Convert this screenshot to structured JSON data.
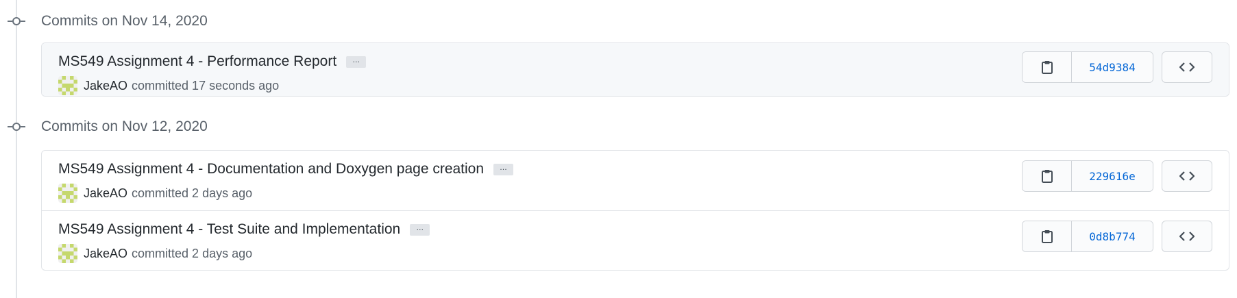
{
  "groups": [
    {
      "title": "Commits on Nov 14, 2020",
      "commits": [
        {
          "title": "MS549 Assignment 4 - Performance Report",
          "author": "JakeAO",
          "committed_text": "committed 17 seconds ago",
          "sha": "54d9384",
          "highlight": true
        }
      ]
    },
    {
      "title": "Commits on Nov 12, 2020",
      "commits": [
        {
          "title": "MS549 Assignment 4 - Documentation and Doxygen page creation",
          "author": "JakeAO",
          "committed_text": "committed 2 days ago",
          "sha": "229616e",
          "highlight": false
        },
        {
          "title": "MS549 Assignment 4 - Test Suite and Implementation",
          "author": "JakeAO",
          "committed_text": "committed 2 days ago",
          "sha": "0d8b774",
          "highlight": false
        }
      ]
    }
  ],
  "ellipsis_label": "···",
  "icons": {
    "commit": "git-commit-icon",
    "copy": "clipboard-icon",
    "browse": "code-icon",
    "avatar": "identicon-avatar"
  },
  "colors": {
    "sha_link": "#0366d6",
    "avatar": "#c5d86d"
  }
}
